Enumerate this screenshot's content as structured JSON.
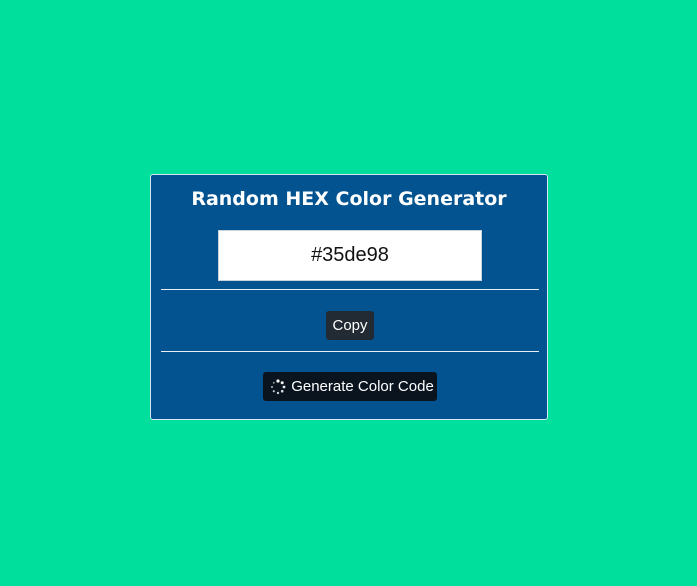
{
  "card": {
    "title": "Random HEX Color Generator",
    "hex_value": "#35de98",
    "copy_label": "Copy",
    "generate_label": "Generate Color Code"
  },
  "colors": {
    "page_background": "#00e09c",
    "card_background": "#02538f",
    "button_dark": "#222a33"
  },
  "icons": {
    "generate_icon": "spinner-icon"
  }
}
